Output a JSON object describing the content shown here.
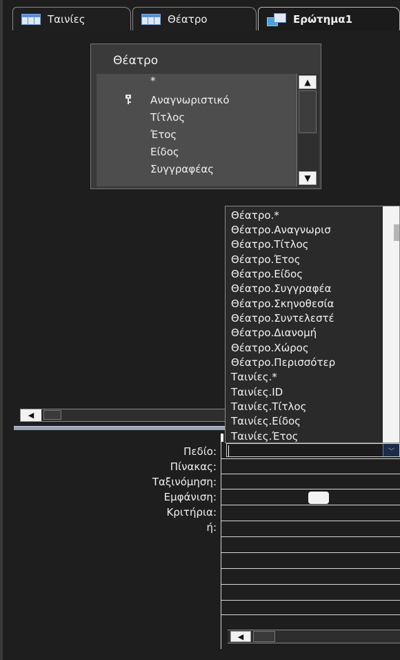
{
  "tabs": [
    {
      "label": "Ταινίες",
      "icon": "table-icon"
    },
    {
      "label": "Θέατρο",
      "icon": "table-icon"
    },
    {
      "label": "Ερώτημα1",
      "icon": "query-icon",
      "active": true
    }
  ],
  "table_box": {
    "title": "Θέατρο",
    "fields": [
      "*",
      "Αναγνωριστικό",
      "Τίτλος",
      "Έτος",
      "Είδος",
      "Συγγραφέας"
    ]
  },
  "dropdown": {
    "items": [
      "Θέατρο.*",
      "Θέατρο.Αναγνωρισ",
      "Θέατρο.Τίτλος",
      "Θέατρο.Έτος",
      "Θέατρο.Είδος",
      "Θέατρο.Συγγραφέα",
      "Θέατρο.Σκηνοθεσία",
      "Θέατρο.Συντελεστέ",
      "Θέατρο.Διανομή",
      "Θέατρο.Χώρος",
      "Θέατρο.Περισσότερ",
      "Ταινίες.*",
      "Ταινίες.ID",
      "Ταινίες.Τίτλος",
      "Ταινίες.Είδος",
      "Ταινίες.Έτος"
    ]
  },
  "grid": {
    "row_labels": [
      "Πεδίο:",
      "Πίνακας:",
      "Ταξινόμηση:",
      "Εμφάνιση:",
      "Κριτήρια:",
      "ή:"
    ],
    "field_value": ""
  },
  "colors": {
    "background": "#1e1e1e",
    "table_box": "#3a3a3a",
    "splitter": "#9aa3b8"
  }
}
